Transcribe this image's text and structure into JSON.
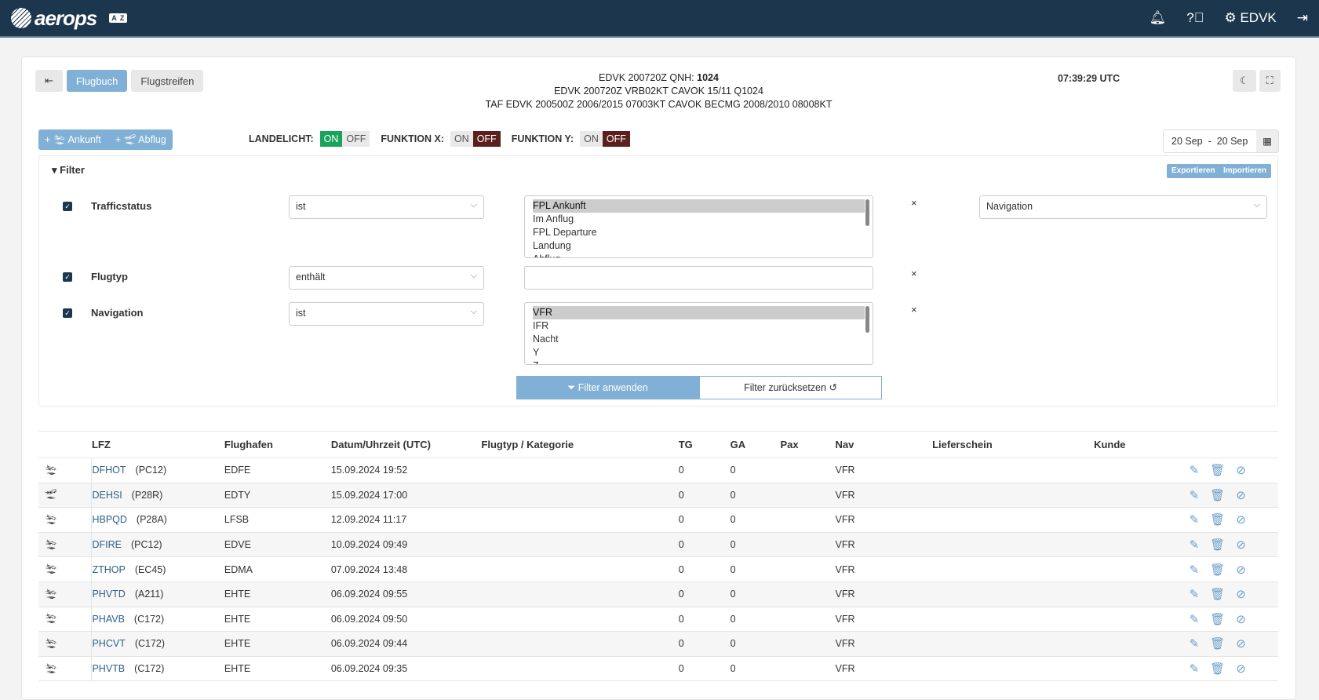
{
  "header": {
    "brand": "aerops",
    "lang_badge": "A Z",
    "station": "EDVK"
  },
  "toolbar": {
    "flugbuch": "Flugbuch",
    "flugstreifen": "Flugstreifen",
    "ankunft": "Ankunft",
    "abflug": "Abflug",
    "clock": "07:39:29 UTC",
    "date_from": "20 Sep",
    "date_sep": "-",
    "date_to": "20 Sep"
  },
  "weather": {
    "line1_prefix": "EDVK 200720Z QNH:",
    "qnh": "1024",
    "line2": "EDVK 200720Z VRB02KT CAVOK 15/11 Q1024",
    "line3": "TAF EDVK 200500Z 2006/2015 07003KT CAVOK BECMG 2008/2010 08008KT"
  },
  "toggles": [
    {
      "label": "LANDELICHT:",
      "on": "ON",
      "off": "OFF",
      "state": "on"
    },
    {
      "label": "FUNKTION X:",
      "on": "ON",
      "off": "OFF",
      "state": "off"
    },
    {
      "label": "FUNKTION Y:",
      "on": "ON",
      "off": "OFF",
      "state": "off"
    }
  ],
  "filter": {
    "title": "Filter",
    "export": "Exportieren",
    "import": "Importieren",
    "apply": "Filter anwenden",
    "reset": "Filter zurücksetzen",
    "add_select": "Navigation",
    "rows": [
      {
        "field": "Trafficstatus",
        "op": "ist",
        "options": [
          "FPL Ankunft",
          "Im Anflug",
          "FPL Departure",
          "Landung",
          "Abflug"
        ]
      },
      {
        "field": "Flugtyp",
        "op": "enthält",
        "value": ""
      },
      {
        "field": "Navigation",
        "op": "ist",
        "options": [
          "VFR",
          "IFR",
          "Nacht",
          "Y",
          "Z"
        ]
      }
    ]
  },
  "table": {
    "columns": [
      "",
      "LFZ",
      "Flughafen",
      "Datum/Uhrzeit (UTC)",
      "Flugtyp / Kategorie",
      "TG",
      "GA",
      "Pax",
      "Nav",
      "Lieferschein",
      "Kunde",
      ""
    ],
    "rows": [
      {
        "dir": "arrival",
        "reg": "DFHOT",
        "type": "(PC12)",
        "apt": "EDFE",
        "dt": "15.09.2024 19:52",
        "tg": "0",
        "ga": "0",
        "nav": "VFR"
      },
      {
        "dir": "departure",
        "reg": "DEHSI",
        "type": "(P28R)",
        "apt": "EDTY",
        "dt": "15.09.2024 17:00",
        "tg": "0",
        "ga": "0",
        "nav": "VFR"
      },
      {
        "dir": "arrival",
        "reg": "HBPQD",
        "type": "(P28A)",
        "apt": "LFSB",
        "dt": "12.09.2024 11:17",
        "tg": "0",
        "ga": "0",
        "nav": "VFR"
      },
      {
        "dir": "arrival",
        "reg": "DFIRE",
        "type": "(PC12)",
        "apt": "EDVE",
        "dt": "10.09.2024 09:49",
        "tg": "0",
        "ga": "0",
        "nav": "VFR"
      },
      {
        "dir": "arrival",
        "reg": "ZTHOP",
        "type": "(EC45)",
        "apt": "EDMA",
        "dt": "07.09.2024 13:48",
        "tg": "0",
        "ga": "0",
        "nav": "VFR"
      },
      {
        "dir": "arrival",
        "reg": "PHVTD",
        "type": "(A211)",
        "apt": "EHTE",
        "dt": "06.09.2024 09:55",
        "tg": "0",
        "ga": "0",
        "nav": "VFR"
      },
      {
        "dir": "arrival",
        "reg": "PHAVB",
        "type": "(C172)",
        "apt": "EHTE",
        "dt": "06.09.2024 09:50",
        "tg": "0",
        "ga": "0",
        "nav": "VFR"
      },
      {
        "dir": "arrival",
        "reg": "PHCVT",
        "type": "(C172)",
        "apt": "EHTE",
        "dt": "06.09.2024 09:44",
        "tg": "0",
        "ga": "0",
        "nav": "VFR"
      },
      {
        "dir": "arrival",
        "reg": "PHVTB",
        "type": "(C172)",
        "apt": "EHTE",
        "dt": "06.09.2024 09:35",
        "tg": "0",
        "ga": "0",
        "nav": "VFR"
      }
    ]
  }
}
